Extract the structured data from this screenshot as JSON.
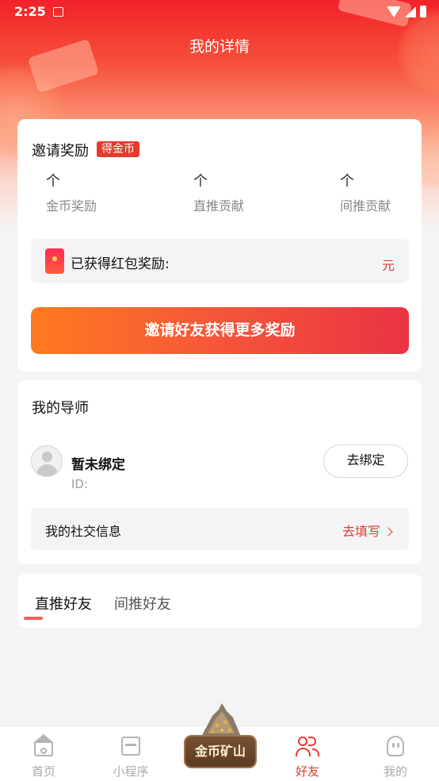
{
  "status_bar": {
    "time": "2:25"
  },
  "header": {
    "title": "我的详情"
  },
  "reward": {
    "title": "邀请奖励",
    "badge": "得金币",
    "stats": [
      {
        "unit": "个",
        "label": "金币奖励"
      },
      {
        "unit": "个",
        "label": "直推贡献"
      },
      {
        "unit": "个",
        "label": "间推贡献"
      }
    ],
    "redpack_label": "已获得红包奖励:",
    "redpack_unit": "元",
    "invite_button": "邀请好友获得更多奖励"
  },
  "mentor": {
    "title": "我的导师",
    "name": "暂未绑定",
    "id_label": "ID:",
    "bind_button": "去绑定",
    "social_label": "我的社交信息",
    "social_link": "去填写"
  },
  "friends_tabs": {
    "tabs": [
      "直推好友",
      "间推好友"
    ],
    "active_index": 0
  },
  "bottom_nav": {
    "items": [
      {
        "label": "首页",
        "icon": "home-icon"
      },
      {
        "label": "小程序",
        "icon": "mini-program-icon"
      },
      {
        "label": "好友",
        "icon": "friends-icon",
        "active": true
      },
      {
        "label": "我的",
        "icon": "profile-icon"
      }
    ],
    "center_label": "金币矿山"
  },
  "colors": {
    "brand_red": "#e53b2f",
    "gradient_start": "#ff7a1e",
    "gradient_end": "#ea3343",
    "muted_text": "#888888"
  }
}
